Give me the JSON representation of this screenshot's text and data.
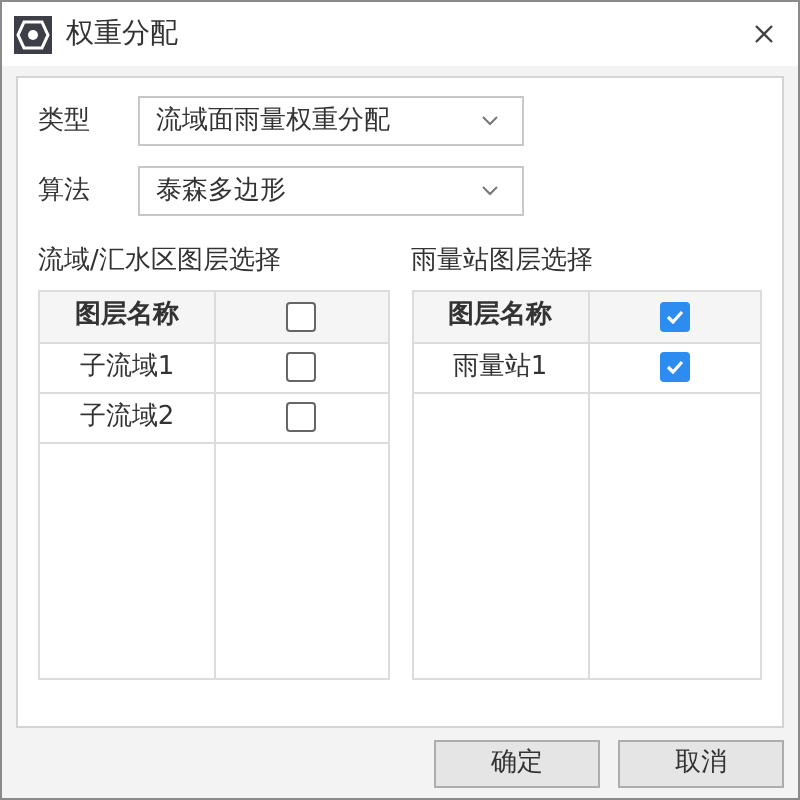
{
  "window": {
    "title": "权重分配"
  },
  "form": [
    {
      "label": "类型",
      "value": "流域面雨量权重分配"
    },
    {
      "label": "算法",
      "value": "泰森多边形"
    }
  ],
  "tables": [
    {
      "title": "流域/汇水区图层选择",
      "column": "图层名称",
      "checked": false,
      "rows": [
        {
          "name": "子流域1",
          "checked": false
        },
        {
          "name": "子流域2",
          "checked": false
        }
      ]
    },
    {
      "title": "雨量站图层选择",
      "column": "图层名称",
      "checked": true,
      "rows": [
        {
          "name": "雨量站1",
          "checked": true
        }
      ]
    }
  ],
  "buttons": [
    "确定",
    "取消"
  ]
}
